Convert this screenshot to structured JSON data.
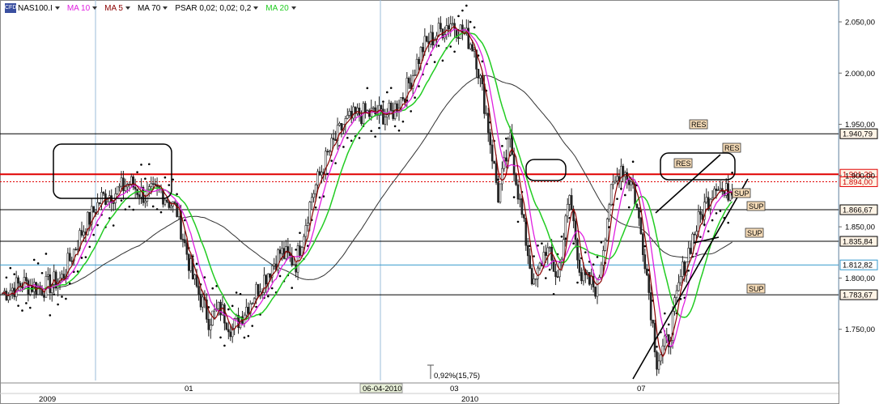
{
  "legend": {
    "symbol_badge": "CFD",
    "items": [
      {
        "label": "NAS100.I",
        "color": "#000000"
      },
      {
        "label": "MA 10",
        "color": "#e020e0"
      },
      {
        "label": "MA 5",
        "color": "#8b0000"
      },
      {
        "label": "MA 70",
        "color": "#222222"
      },
      {
        "label": "PSAR 0,02; 0,02; 0,2",
        "color": "#000000"
      },
      {
        "label": "MA 20",
        "color": "#22cc22"
      }
    ]
  },
  "chart_data": {
    "type": "candlestick",
    "symbol": "NAS100.I",
    "ylim": [
      1700,
      2065
    ],
    "y_ticks": [
      "1.750,00",
      "1.800,00",
      "1.850,00",
      "1.900,00",
      "1.950,00",
      "2.000,00",
      "2.050,00"
    ],
    "x_ticks_top": [
      "01",
      "03",
      "07"
    ],
    "x_ticks_bottom": [
      "2009",
      "2010"
    ],
    "x_highlight": "06-04-2010",
    "trough_note": "0,92%(15,75)",
    "horizontal_levels": [
      {
        "value": 1940.79,
        "label": "1.940,79",
        "color": "#000000",
        "tag": "RES"
      },
      {
        "value": 1901.29,
        "label": "1.901,29",
        "color": "#e00000",
        "tag": "RES"
      },
      {
        "value": 1894.0,
        "label": "1.894,00",
        "color": "#e00000",
        "tag": ""
      },
      {
        "value": 1866.67,
        "label": "1.866,67",
        "color": "#000000",
        "tag": "SUP"
      },
      {
        "value": 1835.84,
        "label": "1.835,84",
        "color": "#000000",
        "tag": "SUP"
      },
      {
        "value": 1812.82,
        "label": "1.812,82",
        "color": "#3399cc",
        "tag": ""
      },
      {
        "value": 1783.67,
        "label": "1.783,67",
        "color": "#000000",
        "tag": "SUP"
      }
    ],
    "tags": [
      "RES",
      "RES",
      "RES",
      "SUP",
      "SUP",
      "SUP",
      "SUP"
    ],
    "price_path": [
      {
        "i": 0,
        "v": 1785
      },
      {
        "i": 10,
        "v": 1795
      },
      {
        "i": 20,
        "v": 1790
      },
      {
        "i": 30,
        "v": 1800
      },
      {
        "i": 40,
        "v": 1845
      },
      {
        "i": 50,
        "v": 1878
      },
      {
        "i": 58,
        "v": 1885
      },
      {
        "i": 64,
        "v": 1893
      },
      {
        "i": 72,
        "v": 1880
      },
      {
        "i": 80,
        "v": 1885
      },
      {
        "i": 88,
        "v": 1865
      },
      {
        "i": 96,
        "v": 1800
      },
      {
        "i": 104,
        "v": 1760
      },
      {
        "i": 110,
        "v": 1770
      },
      {
        "i": 116,
        "v": 1750
      },
      {
        "i": 124,
        "v": 1775
      },
      {
        "i": 132,
        "v": 1800
      },
      {
        "i": 140,
        "v": 1825
      },
      {
        "i": 148,
        "v": 1815
      },
      {
        "i": 156,
        "v": 1880
      },
      {
        "i": 164,
        "v": 1920
      },
      {
        "i": 172,
        "v": 1950
      },
      {
        "i": 180,
        "v": 1960
      },
      {
        "i": 188,
        "v": 1960
      },
      {
        "i": 196,
        "v": 1960
      },
      {
        "i": 204,
        "v": 1985
      },
      {
        "i": 212,
        "v": 2025
      },
      {
        "i": 220,
        "v": 2040
      },
      {
        "i": 226,
        "v": 2050
      },
      {
        "i": 232,
        "v": 2040
      },
      {
        "i": 238,
        "v": 2025
      },
      {
        "i": 244,
        "v": 1960
      },
      {
        "i": 250,
        "v": 1880
      },
      {
        "i": 256,
        "v": 1935
      },
      {
        "i": 262,
        "v": 1860
      },
      {
        "i": 268,
        "v": 1790
      },
      {
        "i": 274,
        "v": 1830
      },
      {
        "i": 280,
        "v": 1800
      },
      {
        "i": 286,
        "v": 1880
      },
      {
        "i": 292,
        "v": 1800
      },
      {
        "i": 300,
        "v": 1790
      },
      {
        "i": 306,
        "v": 1875
      },
      {
        "i": 312,
        "v": 1910
      },
      {
        "i": 318,
        "v": 1890
      },
      {
        "i": 324,
        "v": 1820
      },
      {
        "i": 330,
        "v": 1720
      },
      {
        "i": 336,
        "v": 1740
      },
      {
        "i": 342,
        "v": 1800
      },
      {
        "i": 348,
        "v": 1840
      },
      {
        "i": 354,
        "v": 1870
      },
      {
        "i": 360,
        "v": 1895
      },
      {
        "i": 364,
        "v": 1880
      },
      {
        "i": 368,
        "v": 1890
      }
    ]
  }
}
